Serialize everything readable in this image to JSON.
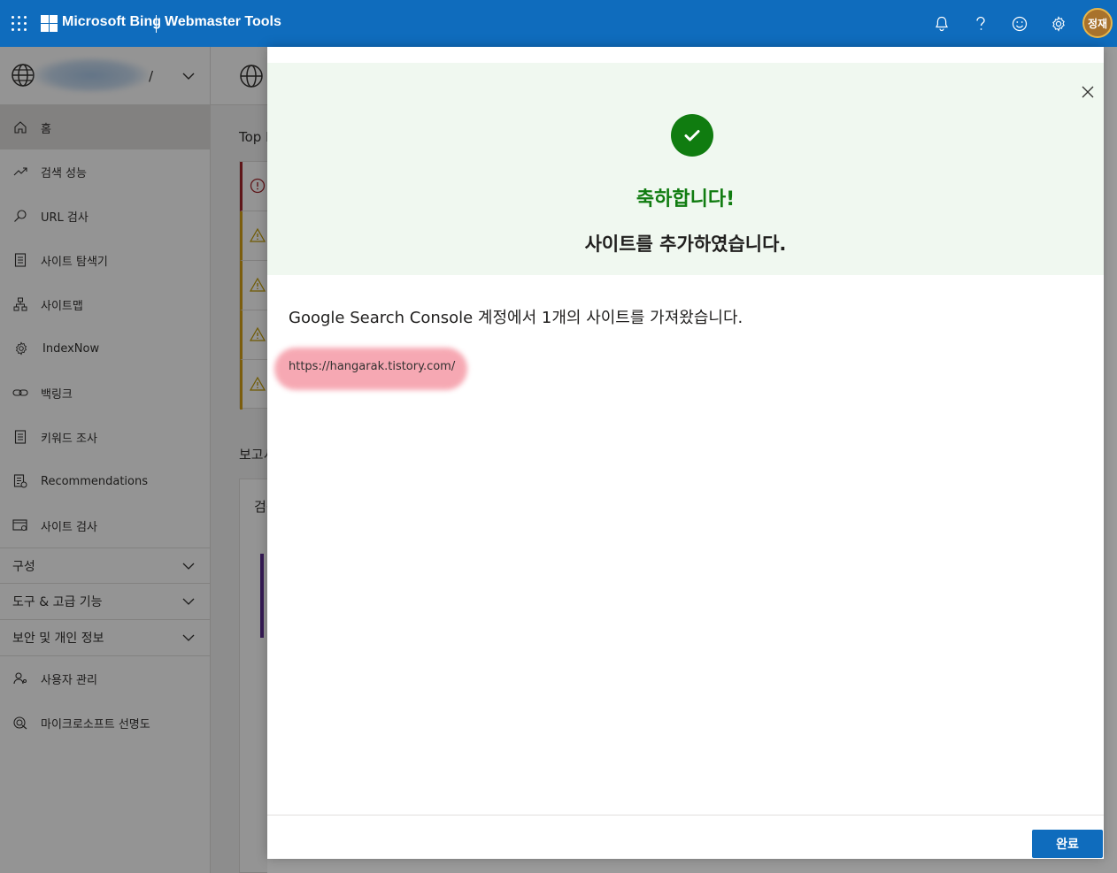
{
  "header": {
    "brand": "Microsoft Bing",
    "product": "Webmaster Tools",
    "avatar_initials": "정재",
    "icons": [
      "waffle-icon",
      "bell-icon",
      "help-icon",
      "smiley-icon",
      "gear-icon"
    ]
  },
  "site_picker": {
    "suffix": "/"
  },
  "sidebar": {
    "items": [
      {
        "label": "홈",
        "icon": "home-icon"
      },
      {
        "label": "검색 성능",
        "icon": "trend-icon"
      },
      {
        "label": "URL 검사",
        "icon": "search-icon"
      },
      {
        "label": "사이트 탐색기",
        "icon": "document-icon"
      },
      {
        "label": "사이트맵",
        "icon": "sitemap-icon"
      },
      {
        "label": "IndexNow",
        "icon": "gear-icon"
      },
      {
        "label": "백링크",
        "icon": "link-icon"
      },
      {
        "label": "키워드 조사",
        "icon": "document-icon"
      },
      {
        "label": "Recommendations",
        "icon": "checklist-icon"
      },
      {
        "label": "사이트 검사",
        "icon": "scan-icon"
      }
    ],
    "groups": [
      {
        "label": "구성"
      },
      {
        "label": "도구 & 고급 기능"
      },
      {
        "label": "보안 및 개인 정보"
      }
    ],
    "bottom_items": [
      {
        "label": "사용자 관리",
        "icon": "user-icon"
      },
      {
        "label": "마이크로소프트 선명도",
        "icon": "clarity-icon"
      }
    ]
  },
  "background": {
    "top_label": "Top I",
    "report_label": "보고서",
    "card_label": "검색"
  },
  "dialog": {
    "title": "축하합니다!",
    "subtitle": "사이트를 추가하였습니다.",
    "message": "Google Search Console 계정에서 1개의 사이트를 가져왔습니다.",
    "imported_site": "https://hangarak.tistory.com/",
    "done_label": "완료",
    "colors": {
      "success": "#107c10",
      "hero_bg": "#f0f8f0",
      "primary": "#0f6cbd"
    }
  }
}
